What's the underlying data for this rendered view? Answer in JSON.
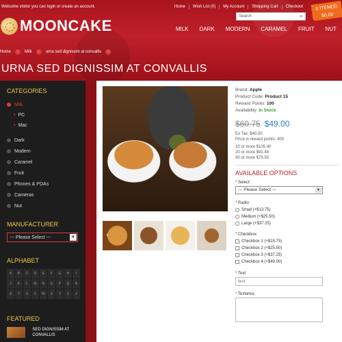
{
  "header": {
    "welcome": "Welcome visitor you can login or create an account.",
    "top_links": [
      "Home",
      "Wish List (0)",
      "My Account",
      "Shopping Cart",
      "Checkout"
    ],
    "search_placeholder": "Search",
    "cart_items": "0 ITEM(S)",
    "cart_total": "$0.00",
    "logo_text": "MOONCAKE",
    "nav": [
      "MILK",
      "DARK",
      "MODERN",
      "CARAMEL",
      "FRUIT",
      "NUT"
    ]
  },
  "breadcrumb": [
    "Home",
    "Milk",
    "urna sed dignissim at convallis"
  ],
  "page_title": "URNA SED DIGNISSIM AT CONVALLIS",
  "sidebar": {
    "categories_title": "CATEGORIES",
    "categories": [
      {
        "label": "Milk",
        "active": true,
        "sub": [
          "PC",
          "Mac"
        ]
      },
      {
        "label": "Dark",
        "active": false
      },
      {
        "label": "Modern",
        "active": false
      },
      {
        "label": "Caramel",
        "active": false
      },
      {
        "label": "Fruit",
        "active": false
      },
      {
        "label": "Phones & PDAs",
        "active": false
      },
      {
        "label": "Cameras",
        "active": false
      },
      {
        "label": "Nut",
        "active": false
      }
    ],
    "manufacturer_title": "MANUFACTURER",
    "manufacturer_select": "--- Please Select ---",
    "alphabet_title": "ALPHABET",
    "alphabet": [
      "A",
      "B",
      "C",
      "D",
      "E",
      "F",
      "G",
      "H",
      "I",
      "J",
      "K",
      "L",
      "M",
      "N",
      "O",
      "P",
      "Q",
      "R",
      "S",
      "T",
      "U",
      "V",
      "W",
      "X",
      "Y",
      "Z",
      "#"
    ],
    "featured_title": "FEATURED",
    "featured_item": "SED DIGNISSIM AT CONVALLIS"
  },
  "product": {
    "brand_label": "Brand:",
    "brand": "Apple",
    "code_label": "Product Code:",
    "code": "Product 15",
    "reward_label": "Reward Points:",
    "reward": "100",
    "availability_label": "Availability:",
    "availability": "In Stock",
    "old_price": "$60.75",
    "new_price": "$49.00",
    "ex_tax": "Ex Tax: $40.00",
    "price_reward": "Price in reward points: 400",
    "discounts": [
      "10 or more $105.40",
      "20 or more $92.48",
      "30 or more $79.55"
    ]
  },
  "options": {
    "title": "AVAILABLE OPTIONS",
    "select_label": "Select:",
    "select_value": "--- Please Select ---",
    "radio_label": "Radio:",
    "radios": [
      "Small (+$13.75)",
      "Medium (+$25.50)",
      "Large (+$37.25)"
    ],
    "checkbox_label": "Checkbox:",
    "checkboxes": [
      "Checkbox 1 (+$15.75)",
      "Checkbox 2 (+$25.50)",
      "Checkbox 3 (+$37.25)",
      "Checkbox 4 (+$49.00)"
    ],
    "text_label": "Text:",
    "text_value": "test",
    "textarea_label": "Textarea:"
  },
  "colors": {
    "header_red": "#b01a22",
    "accent_red": "#c0202a",
    "sidebar_bg": "#1d1d1d",
    "sidebar_heading": "#f2c84b",
    "price_blue": "#2a7fc2",
    "cart_orange": "#f26a1b"
  }
}
